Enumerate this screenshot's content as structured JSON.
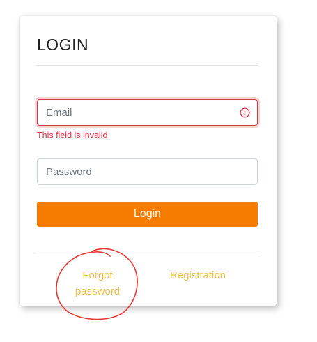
{
  "login_card": {
    "title": "LOGIN",
    "email": {
      "placeholder": "Email",
      "value": "",
      "error": "This field is invalid"
    },
    "password": {
      "placeholder": "Password",
      "value": ""
    },
    "login_button": "Login",
    "links": {
      "forgot_password_line1": "Forgot",
      "forgot_password_line2": "password",
      "registration": "Registration"
    }
  },
  "colors": {
    "accent": "#f57c00",
    "link": "#f0c040",
    "error": "#dc3545",
    "annotation": "#e53935"
  },
  "icons": [
    "exclamation-circle-icon"
  ]
}
